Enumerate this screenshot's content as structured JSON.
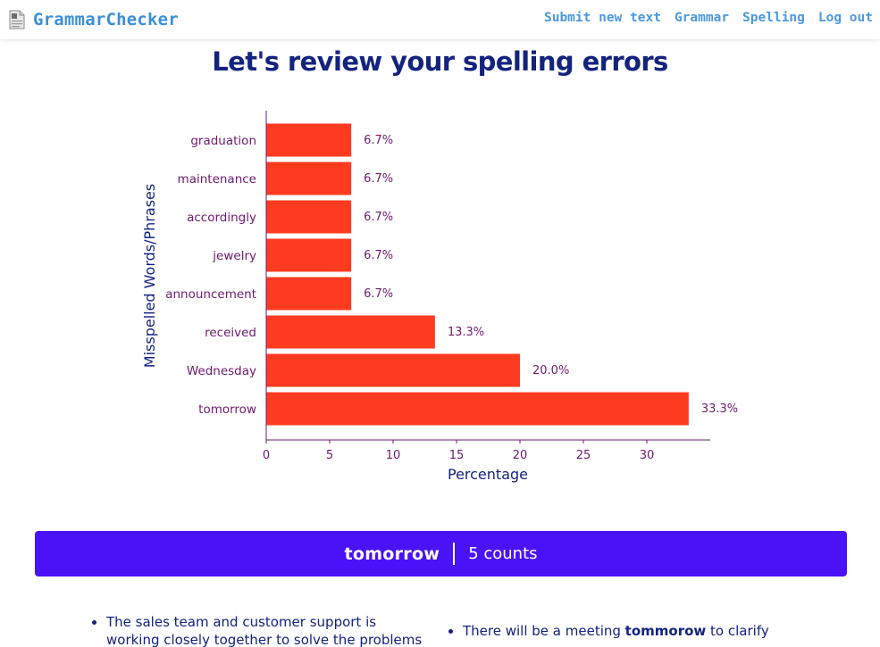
{
  "navbar": {
    "brand": "GrammarChecker",
    "brand_icon": "document-icon",
    "links": [
      {
        "label": "Submit new text"
      },
      {
        "label": "Grammar"
      },
      {
        "label": "Spelling"
      },
      {
        "label": "Log out"
      }
    ],
    "link_color": "#4b98dc"
  },
  "page": {
    "title": "Let's review your spelling errors"
  },
  "chart_data": {
    "type": "bar",
    "orientation": "horizontal",
    "categories": [
      "graduation",
      "maintenance",
      "accordingly",
      "jewelry",
      "announcement",
      "received",
      "Wednesday",
      "tomorrow"
    ],
    "values": [
      6.7,
      6.7,
      6.7,
      6.7,
      6.7,
      13.3,
      20.0,
      33.3
    ],
    "value_labels": [
      "6.7%",
      "6.7%",
      "6.7%",
      "6.7%",
      "6.7%",
      "13.3%",
      "20.0%",
      "33.3%"
    ],
    "xlabel": "Percentage",
    "ylabel": "Misspelled Words/Phrases",
    "xticks": [
      0,
      5,
      10,
      15,
      20,
      25,
      30
    ],
    "xlim": [
      0,
      35
    ],
    "bar_color": "#ff3b1f",
    "grid": false,
    "legend": "none"
  },
  "banner": {
    "word": "tomorrow",
    "count": "5 counts",
    "color": "#4a12f7"
  },
  "examples": {
    "left": {
      "text": "The sales team and customer support is working closely together to solve the problems"
    },
    "right": {
      "before": "There will be a meeting ",
      "highlight": "tommorow",
      "after": " to clarify"
    }
  }
}
